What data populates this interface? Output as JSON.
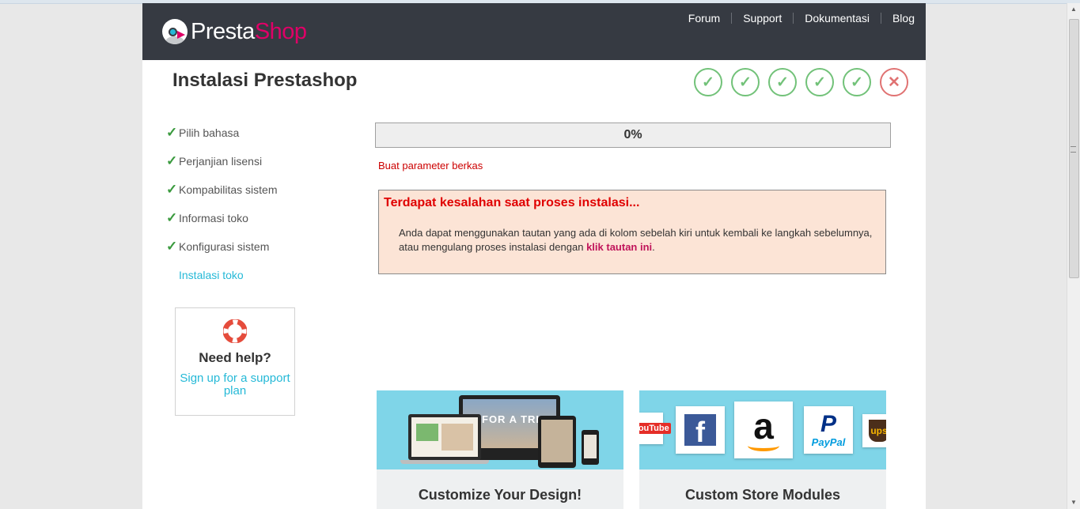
{
  "header": {
    "logo": {
      "part1": "Presta",
      "part2": "Shop"
    },
    "nav": [
      "Forum",
      "Support",
      "Dokumentasi",
      "Blog"
    ]
  },
  "page_title": "Instalasi Prestashop",
  "steps_indicator": [
    {
      "state": "done",
      "icon": "check-icon"
    },
    {
      "state": "done",
      "icon": "check-icon"
    },
    {
      "state": "done",
      "icon": "check-icon"
    },
    {
      "state": "done",
      "icon": "check-icon"
    },
    {
      "state": "done",
      "icon": "check-icon"
    },
    {
      "state": "failed",
      "icon": "cross-icon"
    }
  ],
  "sidebar": {
    "steps": [
      {
        "label": "Pilih bahasa",
        "done": true
      },
      {
        "label": "Perjanjian lisensi",
        "done": true
      },
      {
        "label": "Kompabilitas sistem",
        "done": true
      },
      {
        "label": "Informasi toko",
        "done": true
      },
      {
        "label": "Konfigurasi sistem",
        "done": true
      },
      {
        "label": "Instalasi toko",
        "done": false,
        "current": true
      }
    ],
    "help": {
      "title": "Need help?",
      "link": "Sign up for a support plan"
    }
  },
  "progress": {
    "percent": 0,
    "label": "0%"
  },
  "status_text": "Buat parameter berkas",
  "error": {
    "title": "Terdapat kesalahan saat proses instalasi...",
    "message": "Anda dapat menggunakan tautan yang ada di kolom sebelah kiri untuk kembali ke langkah sebelumnya, atau mengulang proses instalasi dengan",
    "link": "klik tautan ini",
    "suffix": "."
  },
  "promos": [
    {
      "title": "Customize Your Design!",
      "banner_text": "FOR A TRIP"
    },
    {
      "title": "Custom Store Modules",
      "brands": [
        "YouTube",
        "f",
        "a",
        "P",
        "PayPal",
        "ups"
      ]
    }
  ],
  "colors": {
    "header_bg": "#363a42",
    "brand_pink": "#df0067",
    "accent_blue": "#25b9d7",
    "success_green": "#72c279",
    "error_red": "#e00000",
    "error_bg": "#fce4d6"
  }
}
